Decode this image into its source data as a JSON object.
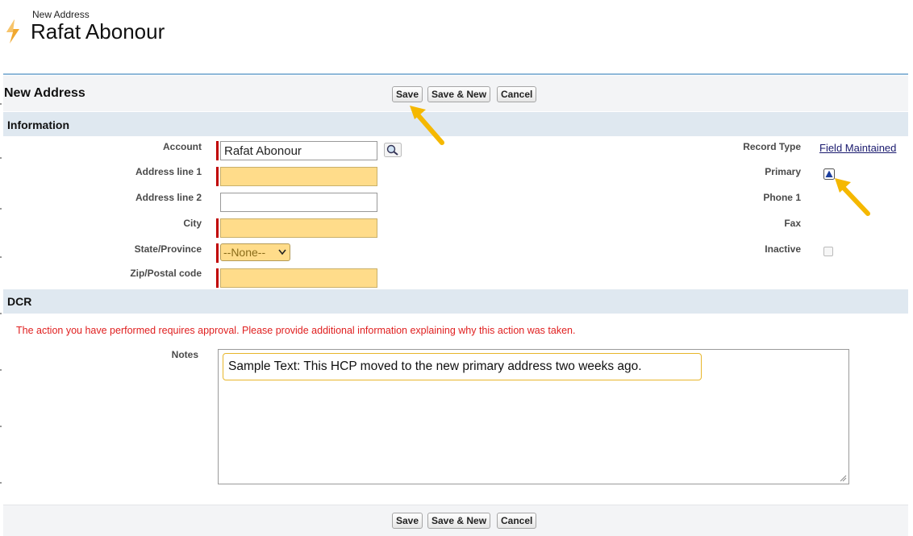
{
  "header": {
    "breadcrumb": "New Address",
    "title": "Rafat Abonour"
  },
  "page_block": {
    "title": "New Address",
    "buttons": {
      "save": "Save",
      "save_new": "Save & New",
      "cancel": "Cancel"
    }
  },
  "information": {
    "section_title": "Information",
    "fields": {
      "account": {
        "label": "Account",
        "value": "Rafat Abonour"
      },
      "address_line_1": {
        "label": "Address line 1",
        "value": ""
      },
      "address_line_2": {
        "label": "Address line 2",
        "value": ""
      },
      "city": {
        "label": "City",
        "value": ""
      },
      "state_province": {
        "label": "State/Province",
        "value": "--None--"
      },
      "zip": {
        "label": "Zip/Postal code",
        "value": ""
      },
      "record_type": {
        "label": "Record Type",
        "value": "Field Maintained"
      },
      "primary": {
        "label": "Primary",
        "checked": true
      },
      "phone": {
        "label": "Phone 1"
      },
      "fax": {
        "label": "Fax"
      },
      "inactive": {
        "label": "Inactive",
        "checked": false
      }
    }
  },
  "dcr": {
    "section_title": "DCR",
    "message": "The action you have performed requires approval. Please provide additional information explaining why this action was taken.",
    "notes_label": "Notes",
    "notes_text": "Sample Text: This HCP moved to the new primary address two weeks ago."
  },
  "colors": {
    "required": "#c00000",
    "highlight_field": "#ffdc8a",
    "section_header": "#dfe8f0",
    "arrow": "#f5b800",
    "error_text": "#e02020"
  }
}
